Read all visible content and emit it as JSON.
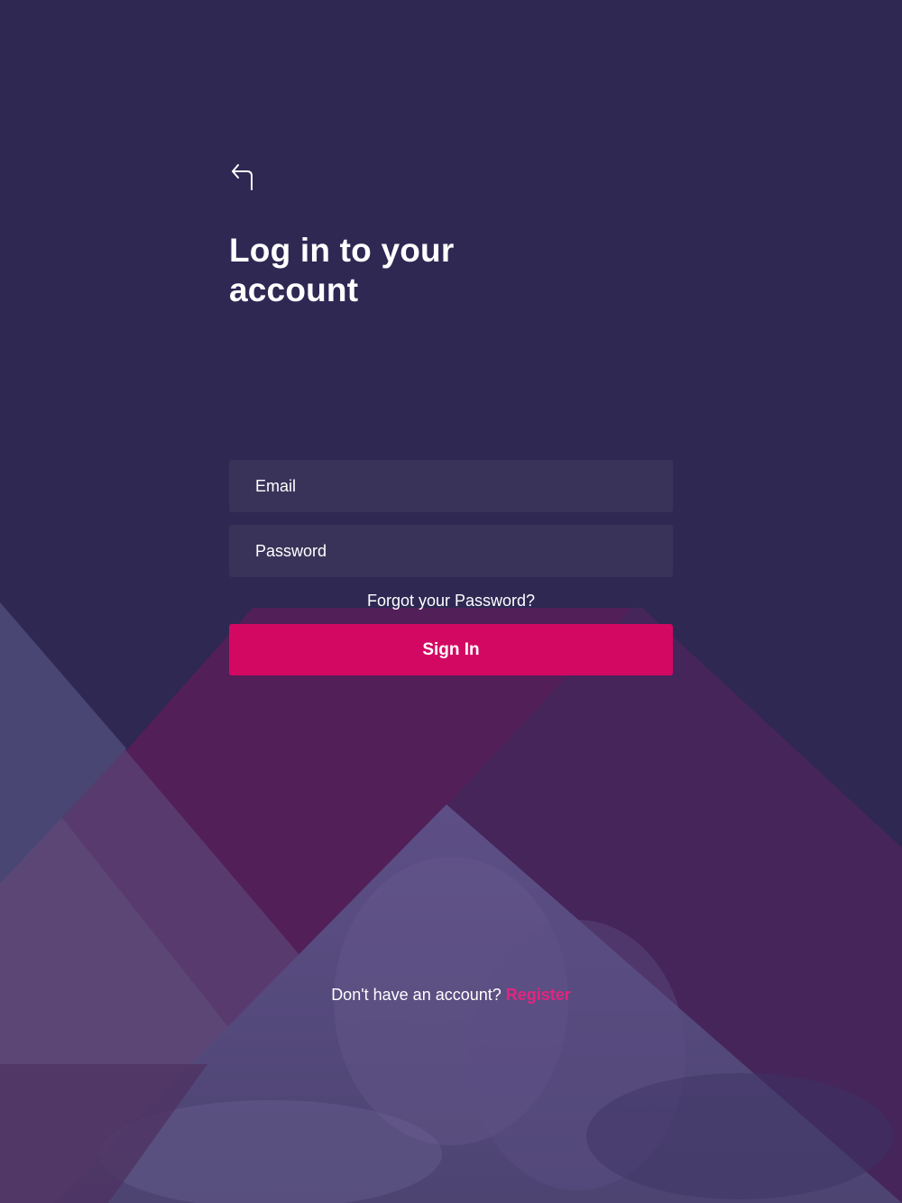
{
  "header": {
    "title": "Log in to your account"
  },
  "form": {
    "email_placeholder": "Email",
    "password_placeholder": "Password",
    "forgot_password_label": "Forgot your Password?",
    "sign_in_label": "Sign In"
  },
  "footer": {
    "prompt": "Don't have an account?",
    "register_label": "Register"
  },
  "icons": {
    "back": "back-arrow-icon"
  },
  "colors": {
    "background": "#2e2853",
    "field_background": "#3a3359",
    "accent": "#d30862",
    "register_link": "#e5247f"
  }
}
